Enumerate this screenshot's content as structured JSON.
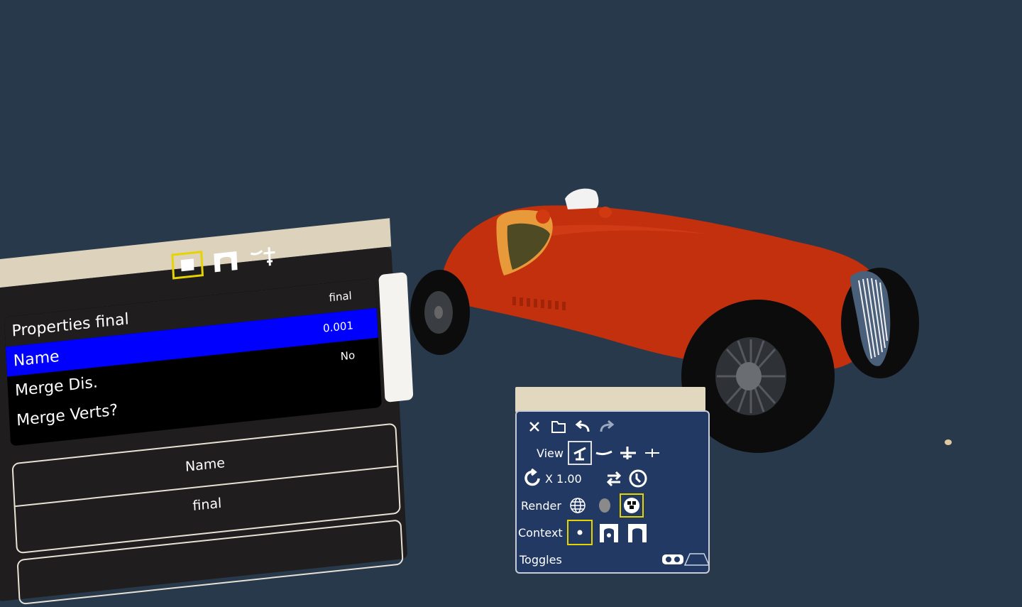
{
  "properties_panel": {
    "header_label": "Properties final",
    "header_value": "final",
    "rows": [
      {
        "label": "Name",
        "value": "0.001",
        "selected": true
      },
      {
        "label": "Merge Dis.",
        "value": "No",
        "selected": false
      },
      {
        "label": "Merge Verts?",
        "value": "",
        "selected": false
      }
    ],
    "detail_name": "Name",
    "detail_value": "final",
    "toolbar_icons": [
      "object-mode-icon",
      "arch-tool-icon",
      "scene-view-icon"
    ]
  },
  "view_panel": {
    "view_label": "View",
    "scale_text": "X 1.00",
    "render_label": "Render",
    "context_label": "Context",
    "toggles_label": "Toggles",
    "icons": [
      "close-icon",
      "folder-icon",
      "undo-icon",
      "redo-icon"
    ]
  },
  "colors": {
    "background": "#27394b",
    "selection_blue": "#0000ff",
    "highlight_yellow": "#e6d400",
    "car_red": "#c2300e"
  }
}
